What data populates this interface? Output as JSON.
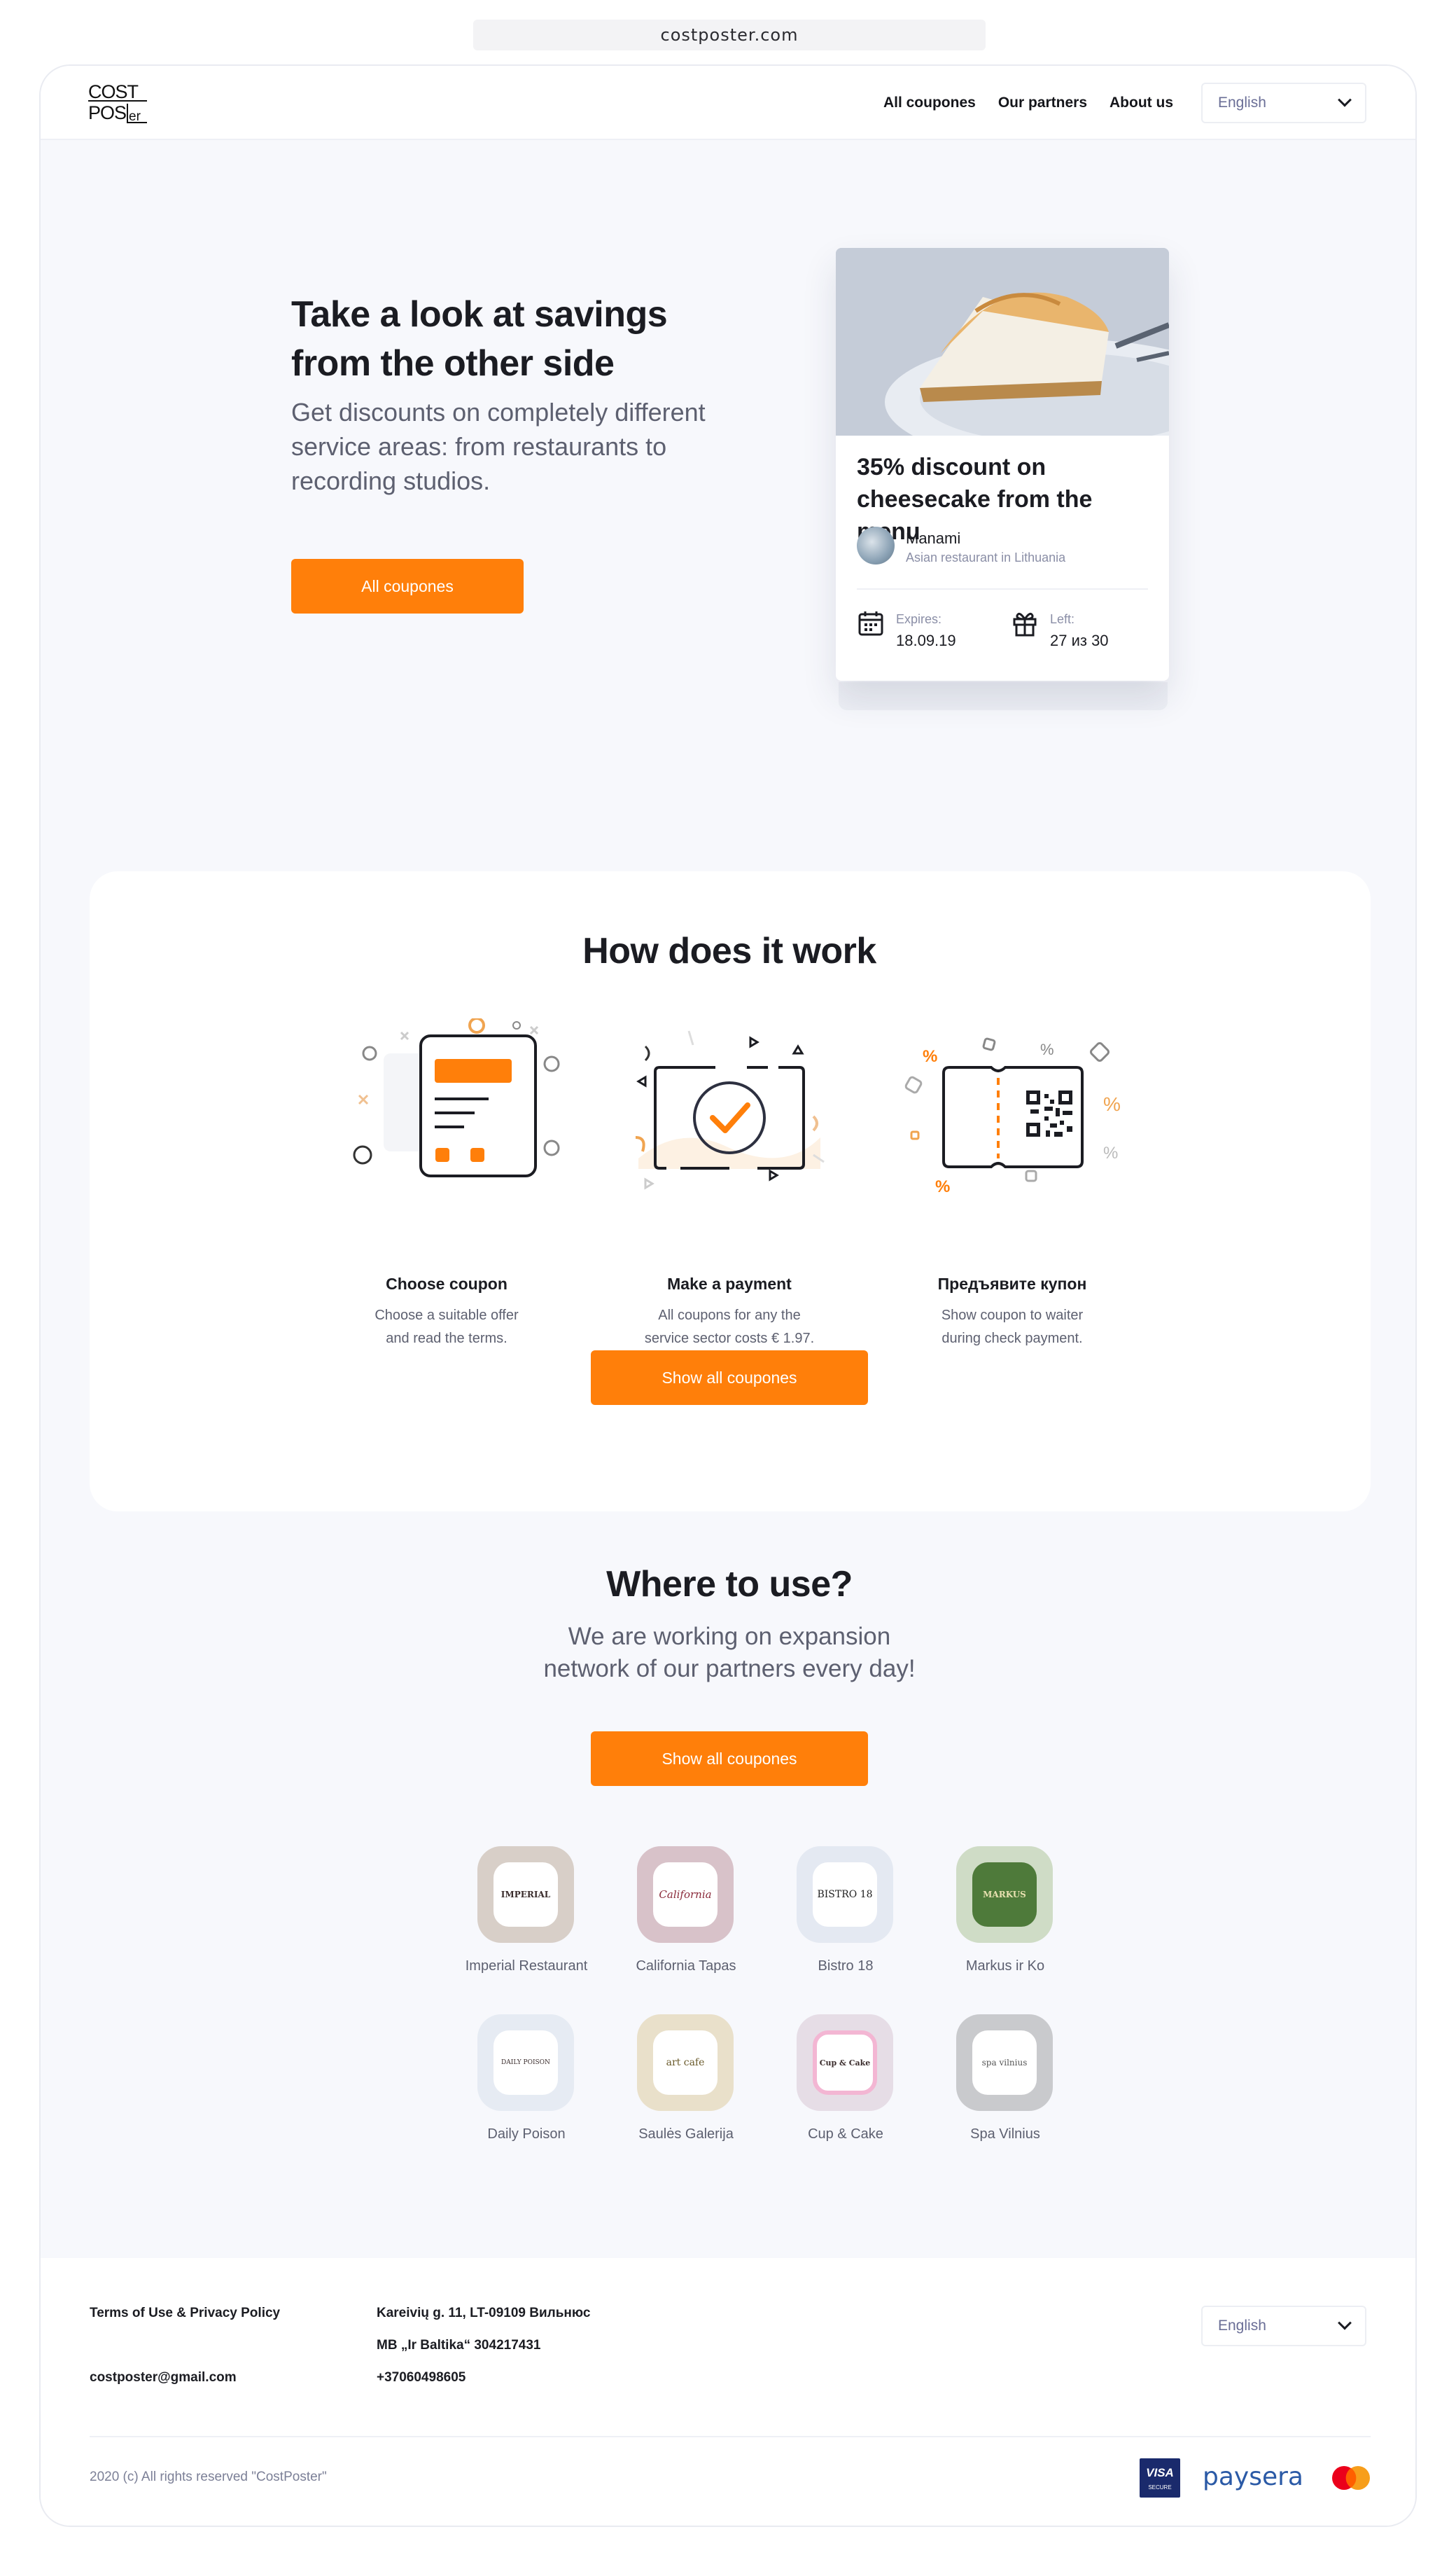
{
  "browser": {
    "url": "costposter.com"
  },
  "header": {
    "logo": "COSTPOSter",
    "nav": [
      "All coupones",
      "Our partners",
      "About us"
    ],
    "language": "English"
  },
  "hero": {
    "title": "Take a look at savings from the other side",
    "subtitle": "Get discounts on completely different service areas: from restaurants to recording studios.",
    "button": "All coupones"
  },
  "coupon_card": {
    "title": "35% discount on cheesecake from the menu",
    "merchant": "Manami",
    "merchant_sub": "Asian restaurant in Lithuania",
    "expires_label": "Expires:",
    "expires_value": "18.09.19",
    "left_label": "Left:",
    "left_value": "27 из 30"
  },
  "how": {
    "title": "How does it work",
    "steps": [
      {
        "title": "Choose coupon",
        "desc_1": "Choose a suitable offer",
        "desc_2": "and read the terms.",
        "icon": "coupon-phone-icon"
      },
      {
        "title": "Make a payment",
        "desc_1": "All coupons for any the",
        "desc_2": "service sector costs € 1.97.",
        "icon": "payment-check-icon"
      },
      {
        "title": "Предъявите купон",
        "desc_1": "Show coupon to waiter",
        "desc_2": "during check payment.",
        "icon": "qr-ticket-icon"
      }
    ],
    "button": "Show all coupones"
  },
  "where": {
    "title": "Where to use?",
    "subtitle_1": "We are working on expansion",
    "subtitle_2": "network of our partners every day!",
    "button": "Show all coupones",
    "partners": [
      {
        "name": "Imperial Restaurant",
        "logo_text": "IMPERIAL",
        "tile": "#d8cfc8"
      },
      {
        "name": "California Tapas",
        "logo_text": "California",
        "tile": "#d8c2c9"
      },
      {
        "name": "Bistro 18",
        "logo_text": "BISTRO 18",
        "tile": "#e4e9f2"
      },
      {
        "name": "Markus ir Ko",
        "logo_text": "MARKUS",
        "tile": "#cfdcc6"
      },
      {
        "name": "Daily Poison",
        "logo_text": "DAILY POISON",
        "tile": "#e6ebf3"
      },
      {
        "name": "Saulės Galerija",
        "logo_text": "art cafe",
        "tile": "#e9e0ca"
      },
      {
        "name": "Cup & Cake",
        "logo_text": "Cup & Cake",
        "tile": "#e6dde6"
      },
      {
        "name": "Spa Vilnius",
        "logo_text": "spa vilnius",
        "tile": "#c9cacd"
      }
    ]
  },
  "footer": {
    "terms": "Terms of Use & Privacy Policy",
    "email": "costposter@gmail.com",
    "address": "Kareivių g. 11, LT-09109 Вильнюс",
    "company": "MB „Ir Baltika“ 304217431",
    "phone": "+37060498605",
    "language": "English",
    "copyright": "2020 (c) All rights reserved \"CostPoster\"",
    "payments": [
      "VISA",
      "paysera",
      "mastercard"
    ],
    "visa_sub": "SECURE"
  },
  "colors": {
    "accent": "#ff7f0a",
    "background": "#f7f8fc",
    "text": "#1b1c22",
    "muted": "#5d6070"
  }
}
